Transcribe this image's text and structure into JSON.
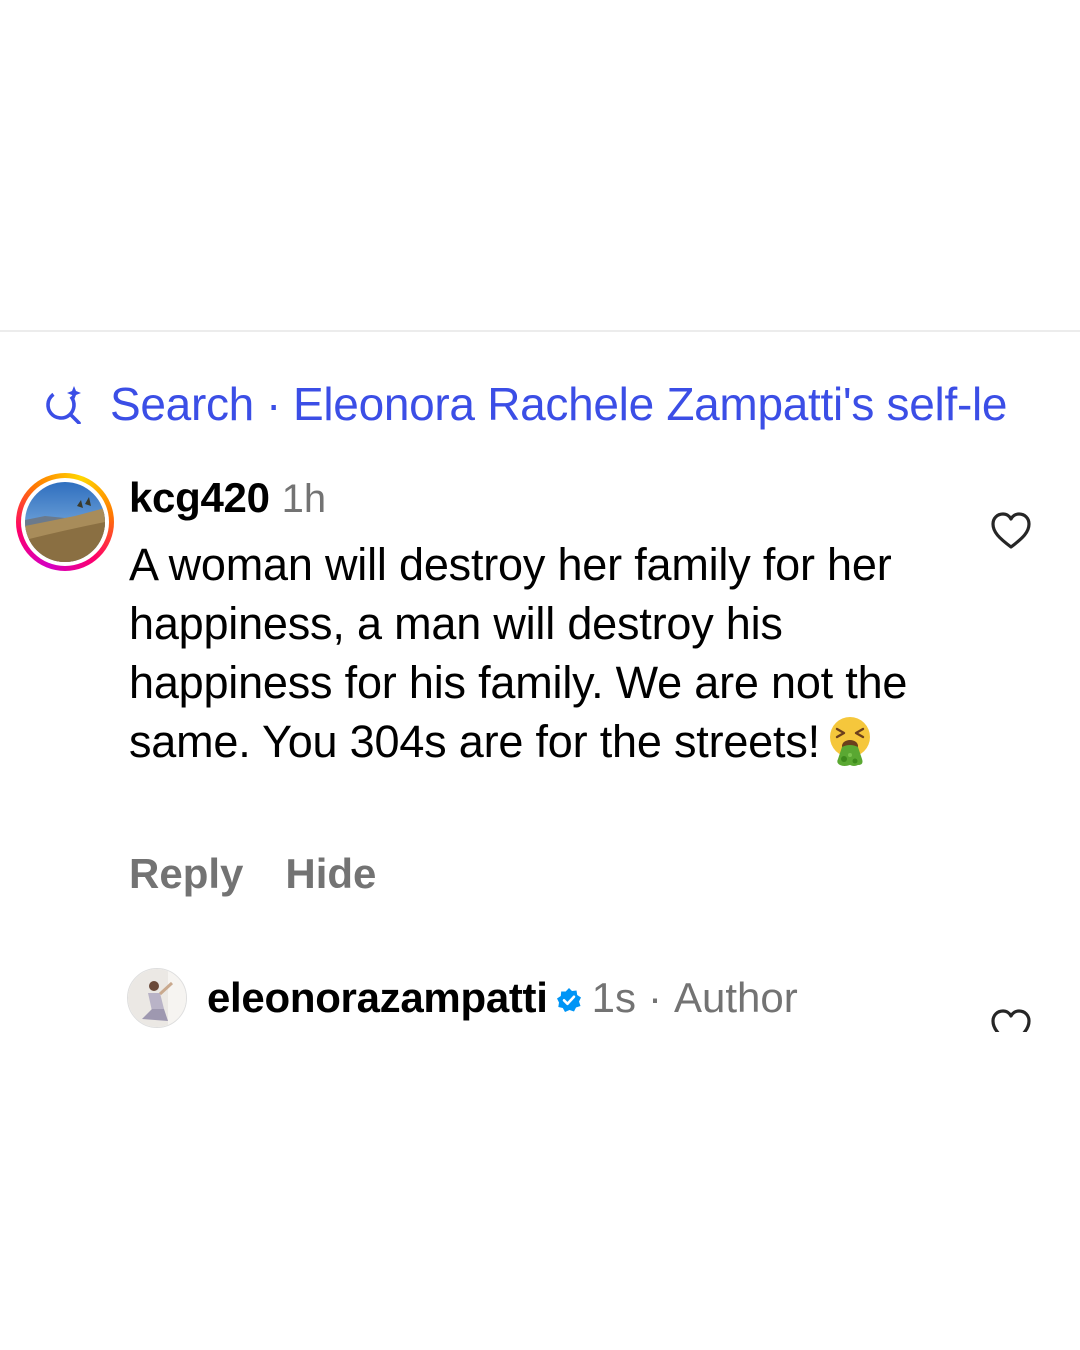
{
  "search": {
    "label": "Search",
    "separator": "·",
    "query": "Eleonora Rachele Zampatti's self-le"
  },
  "comment": {
    "username": "kcg420",
    "time": "1h",
    "text": "A woman will destroy her family for her happiness, a man will destroy his happiness for his family. We are not the same. You 304s are for the streets!",
    "emoji": "vomiting-face-emoji",
    "liked": false
  },
  "actions": {
    "reply_label": "Reply",
    "hide_label": "Hide"
  },
  "reply": {
    "username": "eleonorazampatti",
    "verified": true,
    "time": "1s",
    "separator": "·",
    "badge": "Author",
    "liked": false
  },
  "colors": {
    "link_blue": "#3b4ee6",
    "secondary_gray": "#737373",
    "verified_blue": "#0095f6"
  },
  "icons": {
    "search": "ai-search-sparkle-icon",
    "like": "heart-outline-icon",
    "verified": "verified-badge-icon"
  }
}
